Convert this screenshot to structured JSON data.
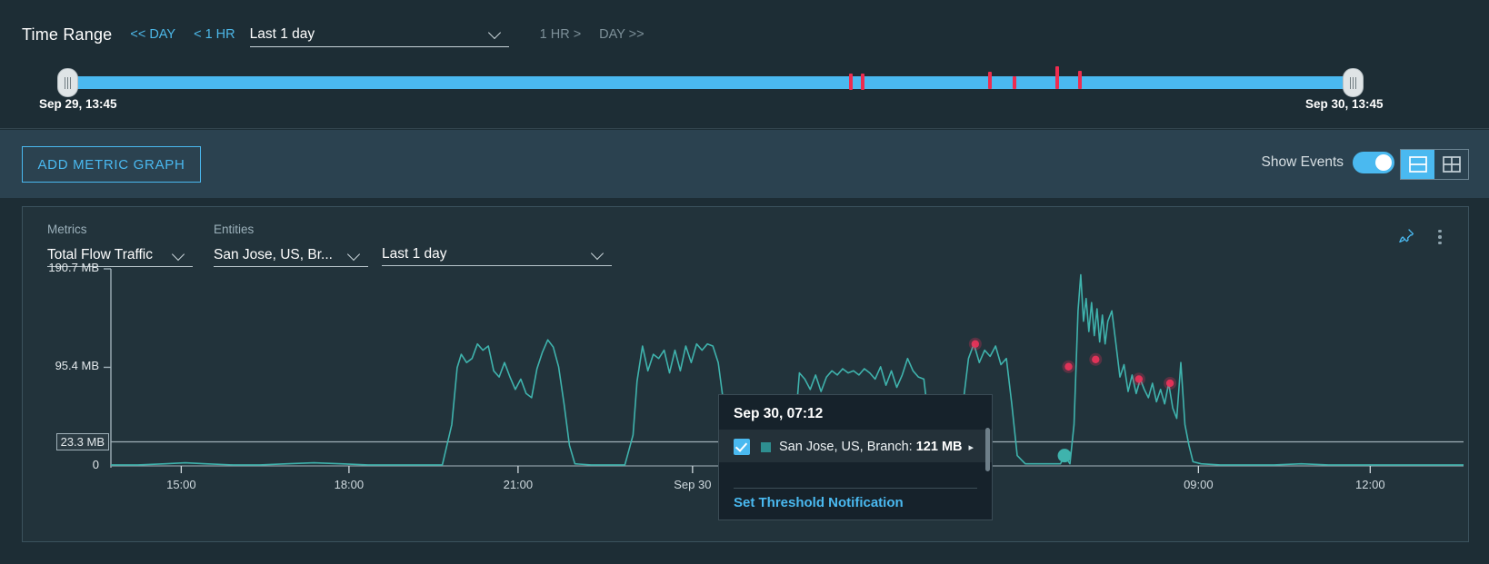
{
  "time_range": {
    "title": "Time Range",
    "prev_day": "<< DAY",
    "prev_hour": "< 1 HR",
    "selected": "Last 1 day",
    "next_hour": "1 HR >",
    "next_day": "DAY >>",
    "start_label": "Sep 29, 13:45",
    "end_label": "Sep 30, 13:45",
    "accent": "#4ab9f0",
    "event_marker_color": "#ee2c4f",
    "event_markers": [
      {
        "pct": 60.8,
        "height": 18,
        "top": -3
      },
      {
        "pct": 61.7,
        "height": 18,
        "top": -3
      },
      {
        "pct": 71.6,
        "height": 19,
        "top": -5
      },
      {
        "pct": 73.5,
        "height": 14,
        "top": 0
      },
      {
        "pct": 76.8,
        "height": 25,
        "top": -11
      },
      {
        "pct": 78.6,
        "height": 20,
        "top": -6
      }
    ]
  },
  "toolbar": {
    "add_metric_graph": "ADD METRIC GRAPH",
    "show_events_label": "Show Events",
    "show_events_on": true,
    "layout_single_name": "single-pane-layout",
    "layout_grid_name": "grid-layout"
  },
  "graph_card": {
    "metrics_label": "Metrics",
    "metrics_value": "Total Flow Traffic",
    "entities_label": "Entities",
    "entities_value": "San Jose, US, Br...",
    "range_value": "Last 1 day",
    "pin_icon": "pin-icon",
    "menu_icon": "kebab-menu-icon"
  },
  "tooltip": {
    "timestamp": "Sep 30, 07:12",
    "series_checked": true,
    "series_color": "#2e8e90",
    "series_name": "San Jose, US, Branch",
    "separator": ":",
    "series_value": "121 MB",
    "expand_caret": "▸",
    "link": "Set Threshold Notification"
  },
  "chart_data": {
    "type": "line",
    "title": "Total Flow Traffic",
    "xlabel": "",
    "ylabel": "",
    "series_name": "San Jose, US, Branch",
    "line_color": "#3fb3ad",
    "grid": false,
    "threshold": {
      "value": 23.3,
      "label": "23.3 MB",
      "color": "#9fb0b8"
    },
    "ylim": [
      0,
      190.7
    ],
    "ytick_labels": [
      "190.7 MB",
      "95.4 MB",
      "23.3 MB",
      "0"
    ],
    "ytick_values": [
      190.7,
      95.4,
      23.3,
      0
    ],
    "xlim": [
      "Sep 29 13:45",
      "Sep 30 13:45"
    ],
    "xtick_labels": [
      "15:00",
      "18:00",
      "21:00",
      "Sep 30",
      "09:00",
      "12:00"
    ],
    "xtick_pct": [
      5.2,
      17.6,
      30.1,
      43.0,
      80.4,
      93.1
    ],
    "anomaly_color": "#e8345a",
    "anomalies": [
      {
        "x_pct": 63.9,
        "y": 118
      },
      {
        "x_pct": 72.8,
        "y": 103
      },
      {
        "x_pct": 76.0,
        "y": 84
      },
      {
        "x_pct": 78.3,
        "y": 80
      },
      {
        "x_pct": 70.8,
        "y": 96
      }
    ],
    "hover_point": {
      "x_pct": 70.5,
      "y": 10,
      "color": "#3fb3ad"
    },
    "points": [
      [
        0.0,
        1
      ],
      [
        2.0,
        1
      ],
      [
        4.0,
        2
      ],
      [
        5.5,
        3
      ],
      [
        7.0,
        2
      ],
      [
        9.0,
        1
      ],
      [
        11.0,
        1
      ],
      [
        13.0,
        2
      ],
      [
        15.0,
        3
      ],
      [
        17.0,
        2
      ],
      [
        19.0,
        1
      ],
      [
        21.0,
        1
      ],
      [
        23.0,
        1
      ],
      [
        24.5,
        1
      ],
      [
        25.2,
        40
      ],
      [
        25.6,
        95
      ],
      [
        25.9,
        108
      ],
      [
        26.3,
        100
      ],
      [
        26.7,
        104
      ],
      [
        27.1,
        118
      ],
      [
        27.5,
        112
      ],
      [
        27.9,
        116
      ],
      [
        28.3,
        92
      ],
      [
        28.7,
        86
      ],
      [
        29.1,
        100
      ],
      [
        29.5,
        86
      ],
      [
        29.9,
        74
      ],
      [
        30.3,
        84
      ],
      [
        30.7,
        70
      ],
      [
        31.1,
        66
      ],
      [
        31.5,
        94
      ],
      [
        31.9,
        110
      ],
      [
        32.3,
        122
      ],
      [
        32.7,
        115
      ],
      [
        33.1,
        96
      ],
      [
        33.5,
        60
      ],
      [
        33.9,
        20
      ],
      [
        34.3,
        2
      ],
      [
        35.5,
        1
      ],
      [
        37.0,
        1
      ],
      [
        38.0,
        1
      ],
      [
        38.6,
        30
      ],
      [
        38.9,
        82
      ],
      [
        39.3,
        116
      ],
      [
        39.7,
        92
      ],
      [
        40.1,
        108
      ],
      [
        40.5,
        104
      ],
      [
        40.9,
        112
      ],
      [
        41.3,
        90
      ],
      [
        41.7,
        112
      ],
      [
        42.1,
        92
      ],
      [
        42.5,
        116
      ],
      [
        42.9,
        100
      ],
      [
        43.3,
        118
      ],
      [
        43.7,
        112
      ],
      [
        44.1,
        118
      ],
      [
        44.5,
        116
      ],
      [
        44.9,
        100
      ],
      [
        45.3,
        60
      ],
      [
        45.7,
        14
      ],
      [
        46.1,
        2
      ],
      [
        47.5,
        1
      ],
      [
        49.0,
        1
      ],
      [
        50.2,
        1
      ],
      [
        50.6,
        40
      ],
      [
        50.9,
        90
      ],
      [
        51.3,
        84
      ],
      [
        51.7,
        74
      ],
      [
        52.1,
        88
      ],
      [
        52.5,
        72
      ],
      [
        52.9,
        86
      ],
      [
        53.3,
        92
      ],
      [
        53.7,
        88
      ],
      [
        54.1,
        94
      ],
      [
        54.5,
        90
      ],
      [
        54.9,
        92
      ],
      [
        55.3,
        88
      ],
      [
        55.7,
        94
      ],
      [
        56.1,
        90
      ],
      [
        56.5,
        84
      ],
      [
        56.9,
        96
      ],
      [
        57.3,
        78
      ],
      [
        57.7,
        92
      ],
      [
        58.1,
        76
      ],
      [
        58.5,
        88
      ],
      [
        58.9,
        104
      ],
      [
        59.3,
        92
      ],
      [
        59.7,
        86
      ],
      [
        60.1,
        84
      ],
      [
        60.5,
        40
      ],
      [
        60.9,
        4
      ],
      [
        61.5,
        2
      ],
      [
        62.5,
        2
      ],
      [
        63.0,
        60
      ],
      [
        63.4,
        104
      ],
      [
        63.8,
        118
      ],
      [
        64.2,
        100
      ],
      [
        64.6,
        112
      ],
      [
        65.0,
        106
      ],
      [
        65.4,
        116
      ],
      [
        65.8,
        98
      ],
      [
        66.2,
        104
      ],
      [
        66.6,
        60
      ],
      [
        67.0,
        10
      ],
      [
        67.6,
        2
      ],
      [
        68.4,
        2
      ],
      [
        68.8,
        2
      ],
      [
        69.6,
        2
      ],
      [
        70.2,
        2
      ],
      [
        70.5,
        10
      ],
      [
        70.9,
        2
      ],
      [
        71.2,
        40
      ],
      [
        71.5,
        150
      ],
      [
        71.7,
        185
      ],
      [
        71.9,
        140
      ],
      [
        72.1,
        162
      ],
      [
        72.3,
        130
      ],
      [
        72.5,
        158
      ],
      [
        72.7,
        126
      ],
      [
        72.9,
        152
      ],
      [
        73.1,
        120
      ],
      [
        73.3,
        146
      ],
      [
        73.5,
        118
      ],
      [
        73.7,
        140
      ],
      [
        74.0,
        150
      ],
      [
        74.3,
        118
      ],
      [
        74.6,
        86
      ],
      [
        74.9,
        98
      ],
      [
        75.2,
        72
      ],
      [
        75.5,
        88
      ],
      [
        75.8,
        70
      ],
      [
        76.1,
        84
      ],
      [
        76.4,
        74
      ],
      [
        76.7,
        66
      ],
      [
        77.0,
        80
      ],
      [
        77.3,
        62
      ],
      [
        77.6,
        74
      ],
      [
        77.9,
        60
      ],
      [
        78.2,
        80
      ],
      [
        78.5,
        56
      ],
      [
        78.8,
        46
      ],
      [
        79.1,
        100
      ],
      [
        79.4,
        40
      ],
      [
        79.7,
        20
      ],
      [
        80.0,
        4
      ],
      [
        80.6,
        2
      ],
      [
        82.0,
        1
      ],
      [
        84.0,
        1
      ],
      [
        86.0,
        1
      ],
      [
        88.0,
        2
      ],
      [
        90.0,
        1
      ],
      [
        92.0,
        1
      ],
      [
        94.0,
        1
      ],
      [
        96.0,
        1
      ],
      [
        98.0,
        1
      ],
      [
        100.0,
        1
      ]
    ]
  }
}
